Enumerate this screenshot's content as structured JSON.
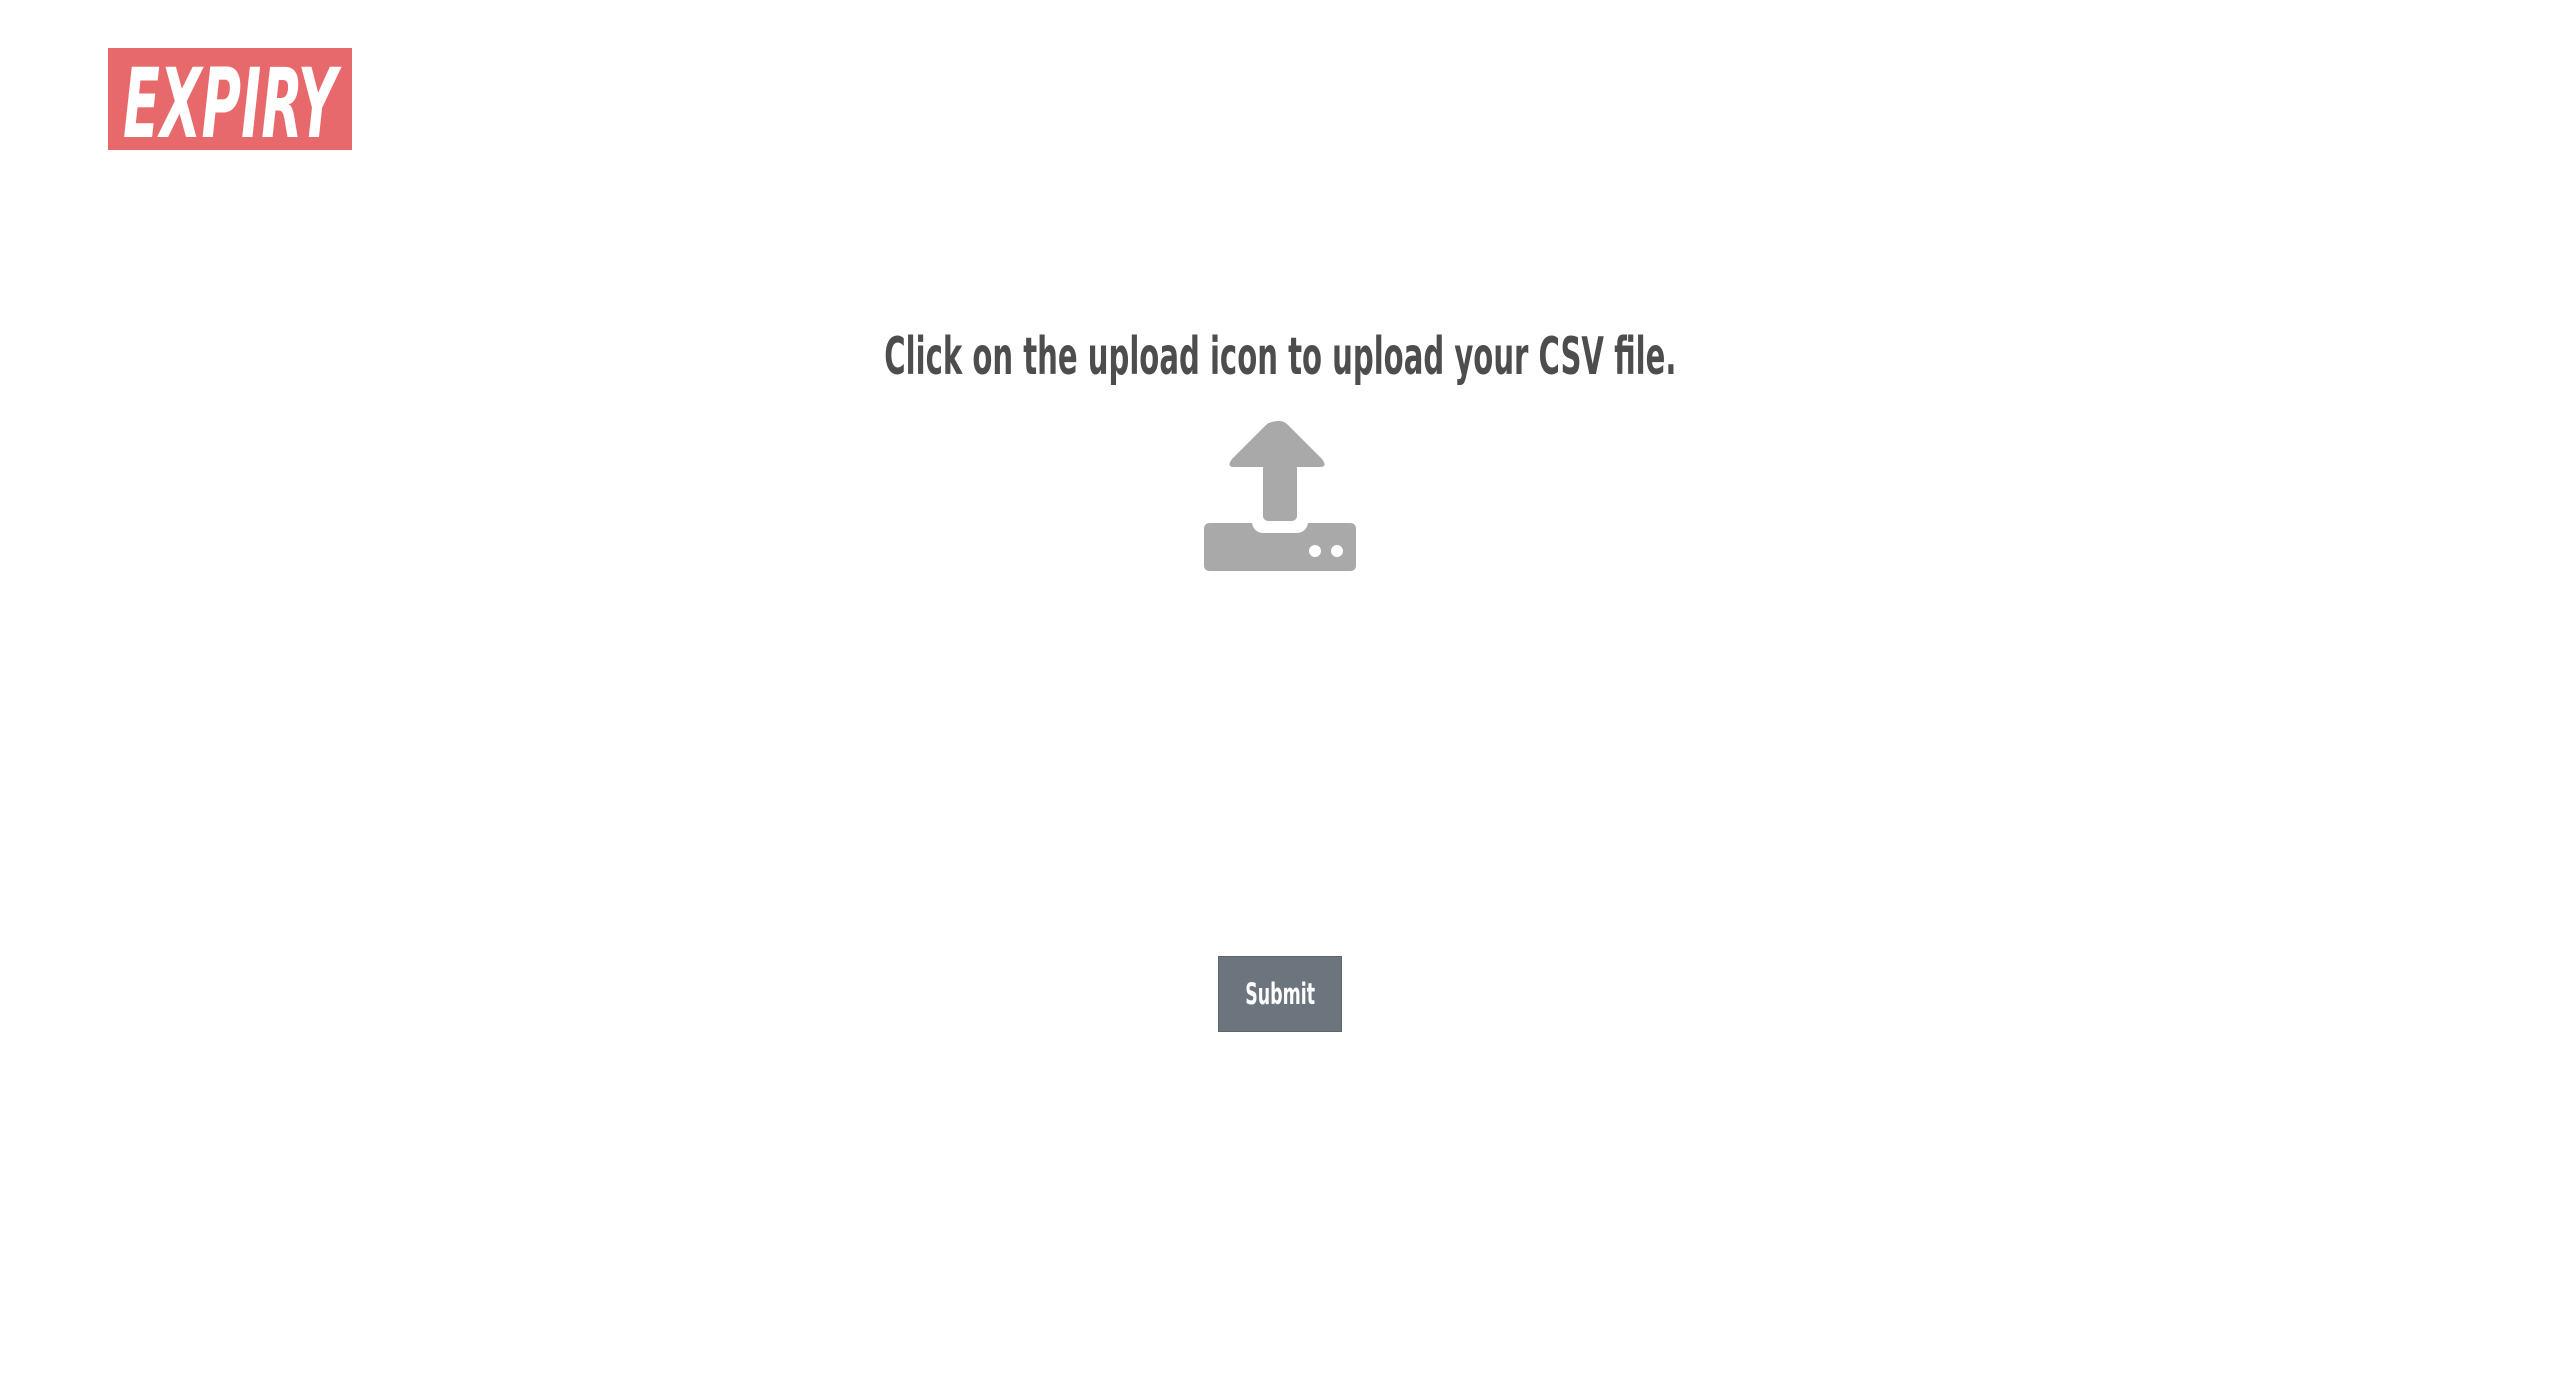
{
  "brand": {
    "logo_text": "EXPIRY",
    "logo_bg_color": "#e8696b"
  },
  "main": {
    "instruction": "Click on the upload icon to upload your CSV file.",
    "upload_icon": "upload-tray-icon",
    "upload_icon_color": "#a9a9a9",
    "submit_label": "Submit",
    "submit_color": "#6c757d"
  }
}
